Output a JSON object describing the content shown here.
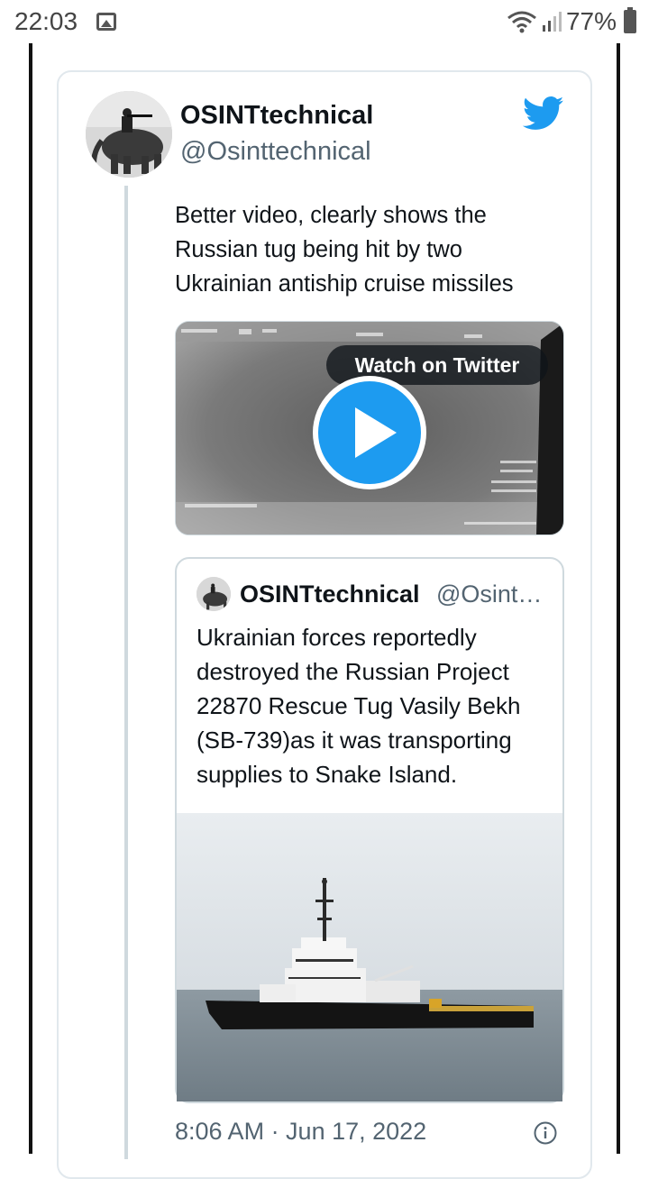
{
  "status_bar": {
    "time": "22:03",
    "battery": "77%",
    "icons": [
      "image-icon",
      "wifi-icon",
      "signal-icon",
      "battery-icon"
    ]
  },
  "tweet": {
    "author_name": "OSINTtechnical",
    "author_handle": "@Osinttechnical",
    "text": "Better video, clearly shows the Russian tug being hit by two Ukrainian antiship cruise missiles",
    "video": {
      "watch_label": "Watch on Twitter"
    },
    "quoted": {
      "author_name": "OSINTtechnical",
      "author_handle": "@Osint…",
      "text": "Ukrainian forces reportedly destroyed the Russian Project 22870 Rescue Tug Vasily Bekh (SB-739)as it was transporting supplies to Snake Island."
    },
    "timestamp": "8:06 AM · Jun 17, 2022"
  },
  "colors": {
    "twitter_blue": "#1d9bf0",
    "text_primary": "#0f1419",
    "text_secondary": "#536471",
    "border": "#cfd9de"
  }
}
